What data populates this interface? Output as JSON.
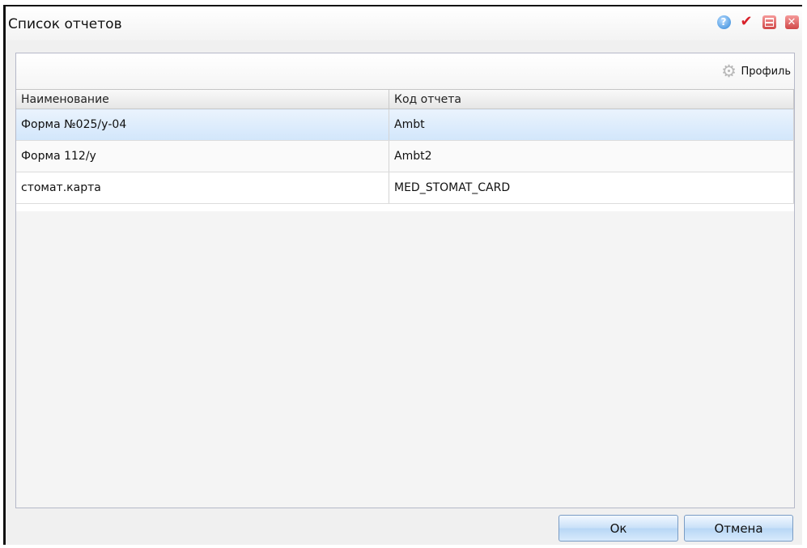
{
  "window": {
    "title": "Список отчетов",
    "icons": [
      "help-icon",
      "check-icon",
      "minimize-icon",
      "close-icon"
    ]
  },
  "toolbar": {
    "profile_label": "Профиль",
    "profile_icon": "gear-icon"
  },
  "grid": {
    "columns": [
      "Наименование",
      "Код отчета"
    ],
    "rows": [
      {
        "name": "Форма №025/у-04",
        "code": "Ambt",
        "selected": true
      },
      {
        "name": "Форма 112/у",
        "code": "Ambt2",
        "selected": false
      },
      {
        "name": "стомат.карта",
        "code": "MED_STOMAT_CARD",
        "selected": false
      }
    ]
  },
  "buttons": {
    "ok_label": "Ок",
    "cancel_label": "Отмена"
  },
  "colors": {
    "selected_row": "#d2e6fb",
    "close_button": "#d04848",
    "check_mark": "#d8202a"
  }
}
